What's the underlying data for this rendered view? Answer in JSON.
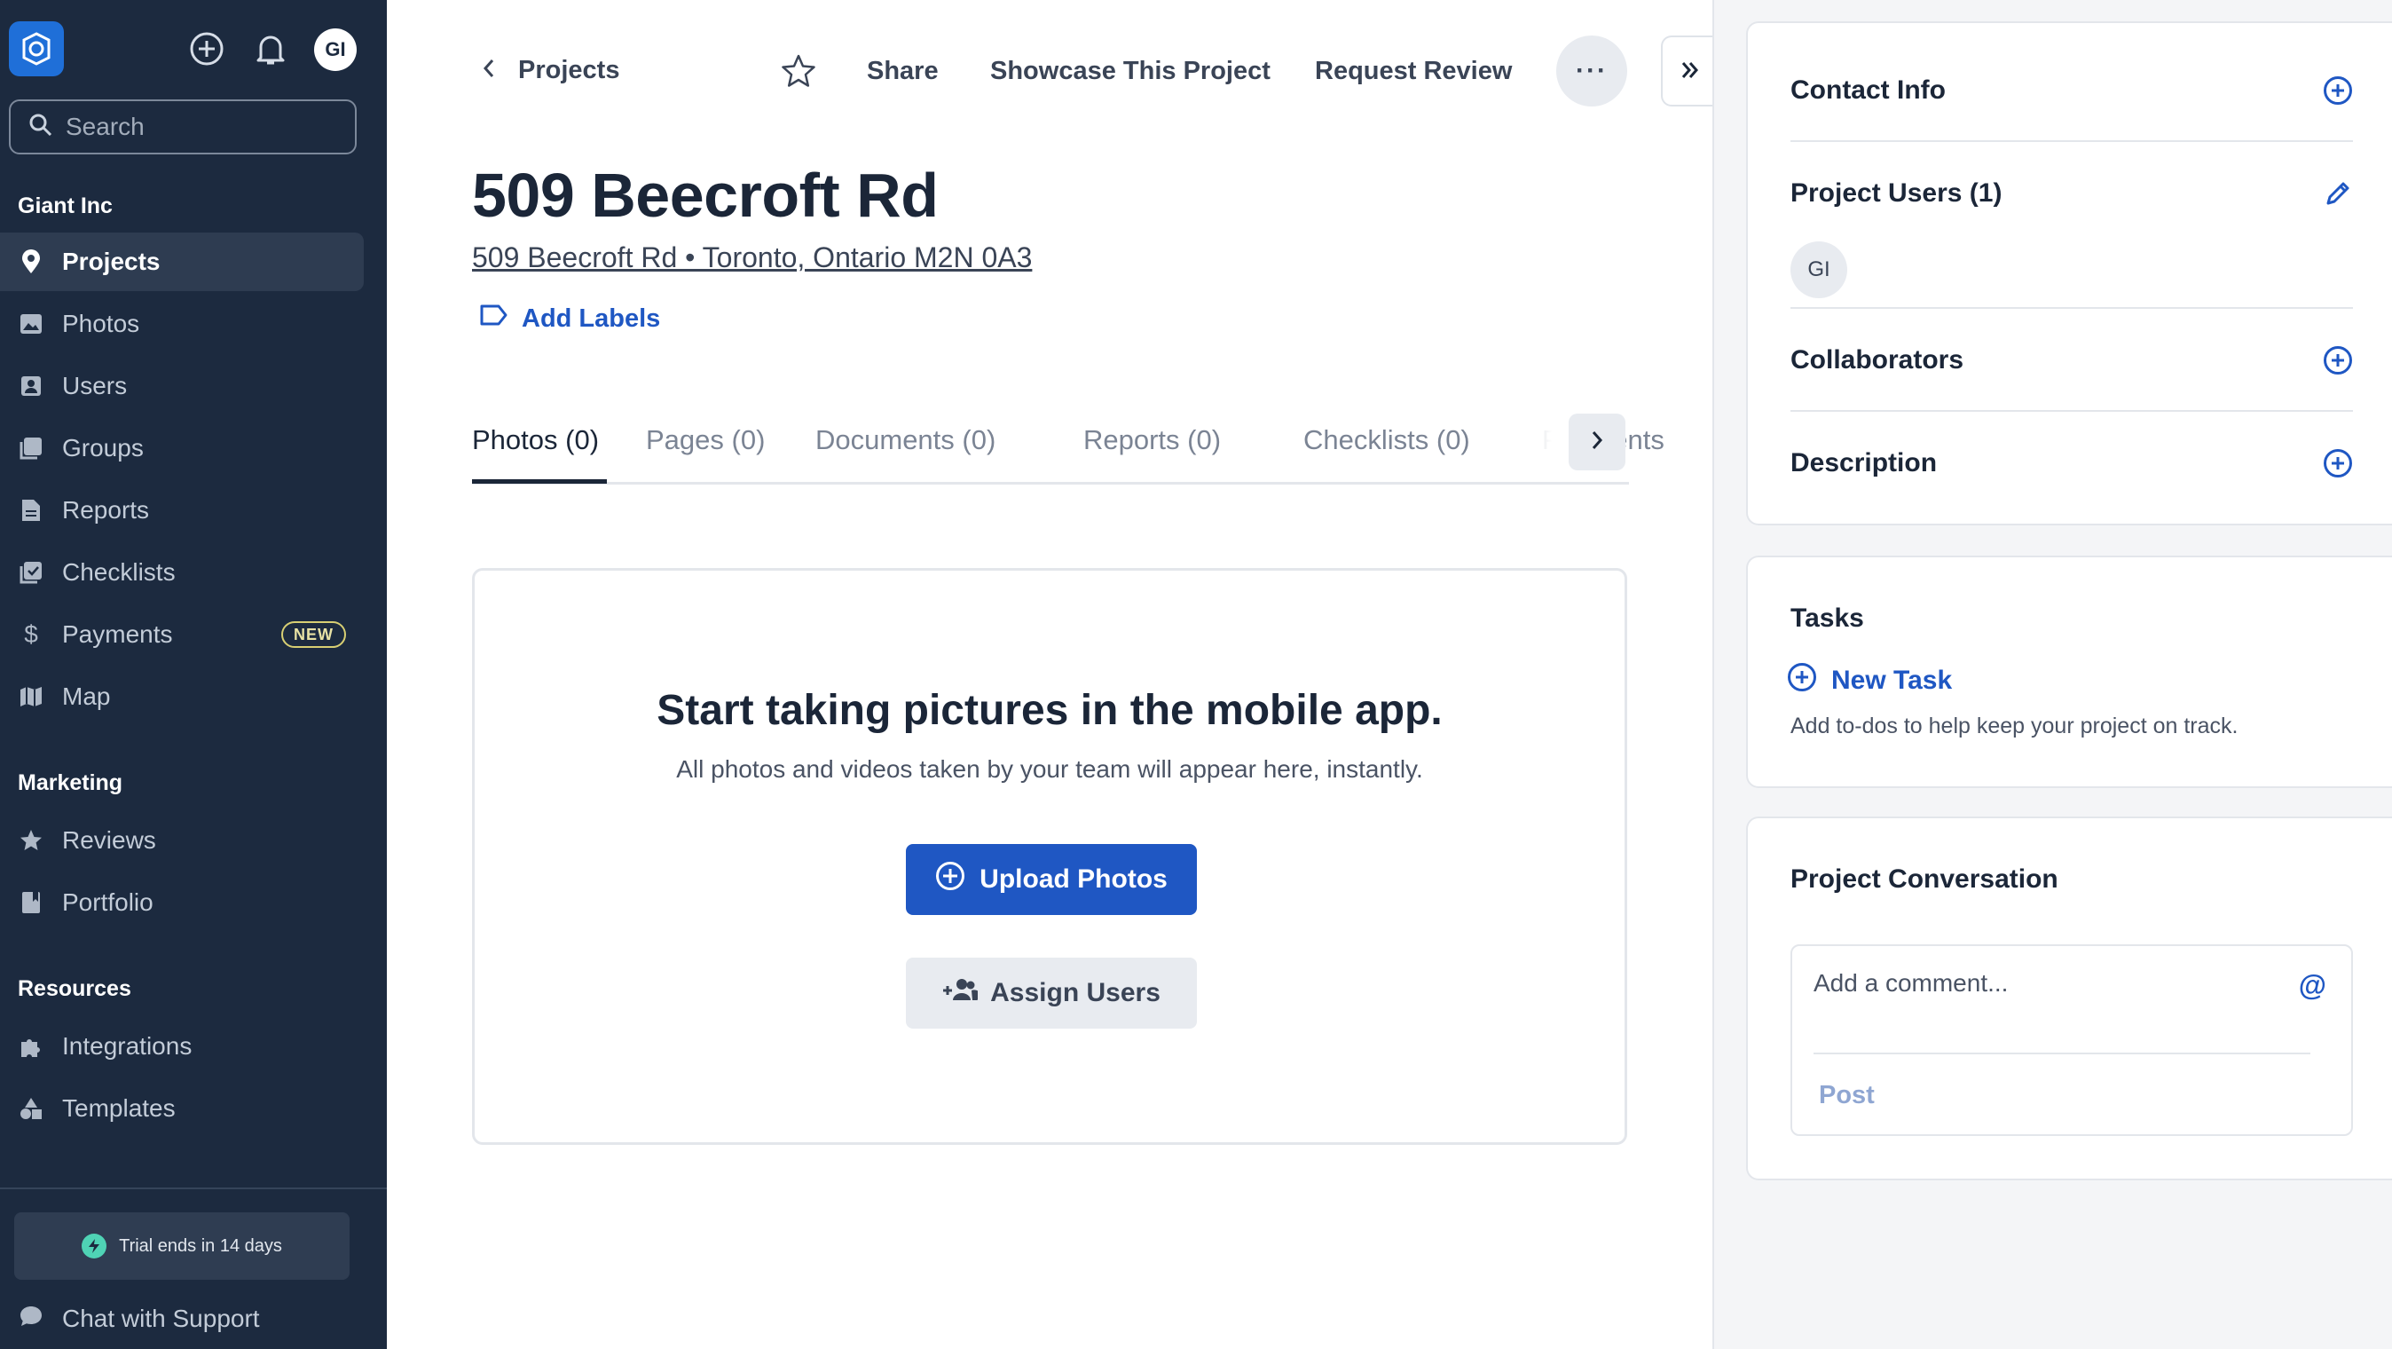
{
  "sidebar": {
    "avatar_initials": "GI",
    "search_placeholder": "Search",
    "org_name": "Giant Inc",
    "items": [
      {
        "label": "Projects",
        "icon": "map-pin-icon"
      },
      {
        "label": "Photos",
        "icon": "photos-icon"
      },
      {
        "label": "Users",
        "icon": "user-icon"
      },
      {
        "label": "Groups",
        "icon": "groups-icon"
      },
      {
        "label": "Reports",
        "icon": "report-icon"
      },
      {
        "label": "Checklists",
        "icon": "checklist-icon"
      },
      {
        "label": "Payments",
        "icon": "dollar-icon",
        "badge": "NEW"
      },
      {
        "label": "Map",
        "icon": "map-icon"
      }
    ],
    "marketing_title": "Marketing",
    "marketing_items": [
      {
        "label": "Reviews",
        "icon": "star-icon"
      },
      {
        "label": "Portfolio",
        "icon": "portfolio-icon"
      }
    ],
    "resources_title": "Resources",
    "resources_items": [
      {
        "label": "Integrations",
        "icon": "puzzle-icon"
      },
      {
        "label": "Templates",
        "icon": "shapes-icon"
      }
    ],
    "trial_text": "Trial ends in 14 days",
    "support_label": "Chat with Support"
  },
  "topbar": {
    "back_label": "Projects",
    "share_label": "Share",
    "showcase_label": "Showcase This Project",
    "review_label": "Request Review",
    "more_label": "···"
  },
  "project": {
    "title": "509 Beecroft Rd",
    "address": "509 Beecroft Rd • Toronto, Ontario M2N 0A3",
    "add_labels": "Add Labels"
  },
  "tabs": [
    {
      "label": "Photos (0)"
    },
    {
      "label": "Pages (0)"
    },
    {
      "label": "Documents (0)"
    },
    {
      "label": "Reports (0)"
    },
    {
      "label": "Checklists (0)"
    },
    {
      "label": "Payments"
    }
  ],
  "empty_state": {
    "title": "Start taking pictures in the mobile app.",
    "subtitle": "All photos and videos taken by your team will appear here, instantly.",
    "upload_label": "Upload Photos",
    "assign_label": "Assign Users"
  },
  "right_panel": {
    "contact_info": "Contact Info",
    "project_users": "Project Users (1)",
    "user_initials": "GI",
    "collaborators": "Collaborators",
    "description": "Description",
    "tasks_title": "Tasks",
    "new_task": "New Task",
    "tasks_help": "Add to-dos to help keep your project on track.",
    "conversation_title": "Project Conversation",
    "comment_placeholder": "Add a comment...",
    "post_label": "Post"
  },
  "colors": {
    "sidebar_bg": "#1c2a3f",
    "accent": "#1f57c3",
    "text_dark": "#1b2638"
  }
}
